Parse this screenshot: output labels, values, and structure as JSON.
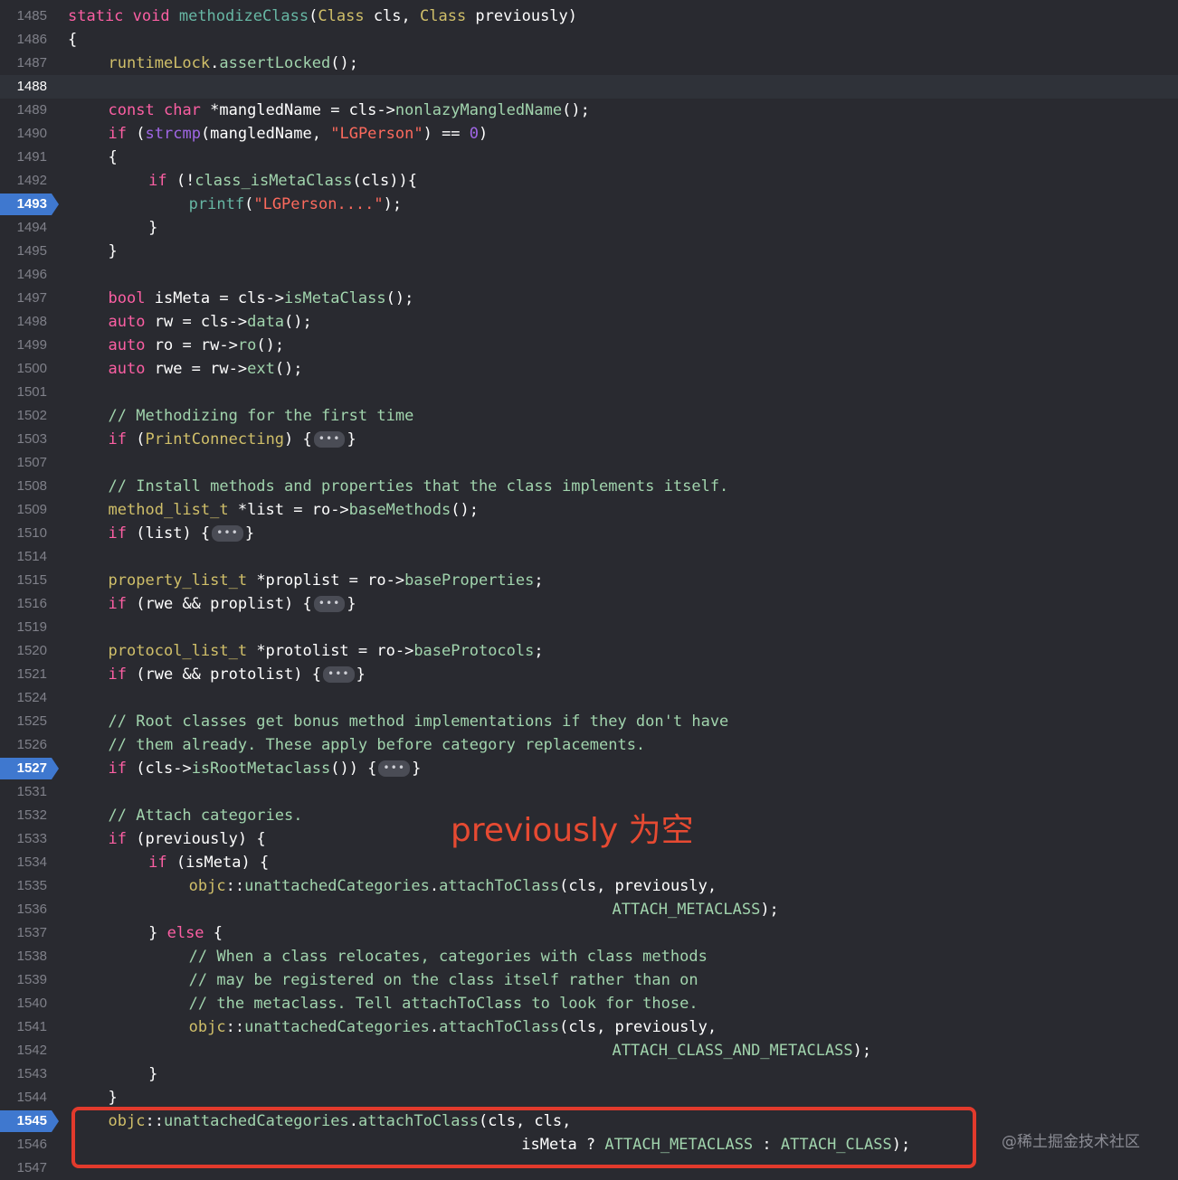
{
  "annotation": "previously 为空",
  "watermark": "@稀土掘金技术社区",
  "lines": [
    {
      "n": "1485",
      "indent": 0,
      "tokens": [
        [
          "static ",
          "k"
        ],
        [
          "void ",
          "k"
        ],
        [
          "methodizeClass",
          "f"
        ],
        [
          "(",
          ""
        ],
        [
          "Class ",
          "t"
        ],
        [
          "cls, ",
          ""
        ],
        [
          "Class ",
          "t"
        ],
        [
          "previously)",
          ""
        ]
      ]
    },
    {
      "n": "1486",
      "indent": 0,
      "tokens": [
        [
          "{",
          ""
        ]
      ]
    },
    {
      "n": "1487",
      "indent": 1,
      "tokens": [
        [
          "runtimeLock",
          "n"
        ],
        [
          ".",
          ""
        ],
        [
          "assertLocked",
          "m"
        ],
        [
          "();",
          ""
        ]
      ]
    },
    {
      "n": "1488",
      "indent": 0,
      "current": true,
      "tokens": []
    },
    {
      "n": "1489",
      "indent": 1,
      "tokens": [
        [
          "const ",
          "k"
        ],
        [
          "char ",
          "k"
        ],
        [
          "*mangledName = cls->",
          ""
        ],
        [
          "nonlazyMangledName",
          "m"
        ],
        [
          "();",
          ""
        ]
      ]
    },
    {
      "n": "1490",
      "indent": 1,
      "tokens": [
        [
          "if ",
          "k"
        ],
        [
          "(",
          ""
        ],
        [
          "strcmp",
          "fn"
        ],
        [
          "(mangledName, ",
          ""
        ],
        [
          "\"LGPerson\"",
          "s"
        ],
        [
          ") == ",
          ""
        ],
        [
          "0",
          "fn"
        ],
        [
          ")",
          ""
        ]
      ]
    },
    {
      "n": "1491",
      "indent": 1,
      "tokens": [
        [
          "{",
          ""
        ]
      ]
    },
    {
      "n": "1492",
      "indent": 2,
      "tokens": [
        [
          "if ",
          "k"
        ],
        [
          "(!",
          ""
        ],
        [
          "class_isMetaClass",
          "m"
        ],
        [
          "(cls)){",
          ""
        ]
      ]
    },
    {
      "n": "1493",
      "indent": 3,
      "bp": true,
      "tokens": [
        [
          "printf",
          "f"
        ],
        [
          "(",
          ""
        ],
        [
          "\"LGPerson....\"",
          "s"
        ],
        [
          ");",
          ""
        ]
      ]
    },
    {
      "n": "1494",
      "indent": 2,
      "tokens": [
        [
          "}",
          ""
        ]
      ]
    },
    {
      "n": "1495",
      "indent": 1,
      "tokens": [
        [
          "}",
          ""
        ]
      ]
    },
    {
      "n": "1496",
      "indent": 0,
      "tokens": []
    },
    {
      "n": "1497",
      "indent": 1,
      "tokens": [
        [
          "bool ",
          "k"
        ],
        [
          "isMeta = cls->",
          ""
        ],
        [
          "isMetaClass",
          "m"
        ],
        [
          "();",
          ""
        ]
      ]
    },
    {
      "n": "1498",
      "indent": 1,
      "tokens": [
        [
          "auto ",
          "k"
        ],
        [
          "rw = cls->",
          ""
        ],
        [
          "data",
          "m"
        ],
        [
          "();",
          ""
        ]
      ]
    },
    {
      "n": "1499",
      "indent": 1,
      "tokens": [
        [
          "auto ",
          "k"
        ],
        [
          "ro = rw->",
          ""
        ],
        [
          "ro",
          "m"
        ],
        [
          "();",
          ""
        ]
      ]
    },
    {
      "n": "1500",
      "indent": 1,
      "tokens": [
        [
          "auto ",
          "k"
        ],
        [
          "rwe = rw->",
          ""
        ],
        [
          "ext",
          "m"
        ],
        [
          "();",
          ""
        ]
      ]
    },
    {
      "n": "1501",
      "indent": 0,
      "tokens": []
    },
    {
      "n": "1502",
      "indent": 1,
      "tokens": [
        [
          "// Methodizing for the first time",
          "m"
        ]
      ]
    },
    {
      "n": "1503",
      "indent": 1,
      "tokens": [
        [
          "if ",
          "k"
        ],
        [
          "(",
          ""
        ],
        [
          "PrintConnecting",
          "n"
        ],
        [
          ") {",
          ""
        ],
        [
          "•••",
          "fold"
        ],
        [
          "}",
          ""
        ]
      ]
    },
    {
      "n": "1507",
      "indent": 0,
      "tokens": []
    },
    {
      "n": "1508",
      "indent": 1,
      "tokens": [
        [
          "// Install methods and properties that the class implements itself.",
          "m"
        ]
      ]
    },
    {
      "n": "1509",
      "indent": 1,
      "tokens": [
        [
          "method_list_t ",
          "n"
        ],
        [
          "*list = ro->",
          ""
        ],
        [
          "baseMethods",
          "m"
        ],
        [
          "();",
          ""
        ]
      ]
    },
    {
      "n": "1510",
      "indent": 1,
      "tokens": [
        [
          "if ",
          "k"
        ],
        [
          "(list) {",
          ""
        ],
        [
          "•••",
          "fold"
        ],
        [
          "}",
          ""
        ]
      ]
    },
    {
      "n": "1514",
      "indent": 0,
      "tokens": []
    },
    {
      "n": "1515",
      "indent": 1,
      "tokens": [
        [
          "property_list_t ",
          "n"
        ],
        [
          "*proplist = ro->",
          ""
        ],
        [
          "baseProperties",
          "m"
        ],
        [
          ";",
          ""
        ]
      ]
    },
    {
      "n": "1516",
      "indent": 1,
      "tokens": [
        [
          "if ",
          "k"
        ],
        [
          "(rwe && proplist) {",
          ""
        ],
        [
          "•••",
          "fold"
        ],
        [
          "}",
          ""
        ]
      ]
    },
    {
      "n": "1519",
      "indent": 0,
      "tokens": []
    },
    {
      "n": "1520",
      "indent": 1,
      "tokens": [
        [
          "protocol_list_t ",
          "n"
        ],
        [
          "*protolist = ro->",
          ""
        ],
        [
          "baseProtocols",
          "m"
        ],
        [
          ";",
          ""
        ]
      ]
    },
    {
      "n": "1521",
      "indent": 1,
      "tokens": [
        [
          "if ",
          "k"
        ],
        [
          "(rwe && protolist) {",
          ""
        ],
        [
          "•••",
          "fold"
        ],
        [
          "}",
          ""
        ]
      ]
    },
    {
      "n": "1524",
      "indent": 0,
      "tokens": []
    },
    {
      "n": "1525",
      "indent": 1,
      "tokens": [
        [
          "// Root classes get bonus method implementations if they don't have",
          "m"
        ]
      ]
    },
    {
      "n": "1526",
      "indent": 1,
      "tokens": [
        [
          "// them already. These apply before category replacements.",
          "m"
        ]
      ]
    },
    {
      "n": "1527",
      "indent": 1,
      "bp": true,
      "tokens": [
        [
          "if ",
          "k"
        ],
        [
          "(cls->",
          ""
        ],
        [
          "isRootMetaclass",
          "m"
        ],
        [
          "()) {",
          ""
        ],
        [
          "•••",
          "fold"
        ],
        [
          "}",
          ""
        ]
      ]
    },
    {
      "n": "1531",
      "indent": 0,
      "tokens": []
    },
    {
      "n": "1532",
      "indent": 1,
      "tokens": [
        [
          "// Attach categories.",
          "m"
        ]
      ]
    },
    {
      "n": "1533",
      "indent": 1,
      "tokens": [
        [
          "if ",
          "k"
        ],
        [
          "(previously) {",
          ""
        ]
      ]
    },
    {
      "n": "1534",
      "indent": 2,
      "tokens": [
        [
          "if ",
          "k"
        ],
        [
          "(isMeta) {",
          ""
        ]
      ]
    },
    {
      "n": "1535",
      "indent": 3,
      "tokens": [
        [
          "objc",
          "n"
        ],
        [
          "::",
          ""
        ],
        [
          "unattachedCategories",
          "m"
        ],
        [
          ".",
          ""
        ],
        [
          "attachToClass",
          "m"
        ],
        [
          "(cls, previously,",
          ""
        ]
      ]
    },
    {
      "n": "1536",
      "indent": 13.5,
      "tokens": [
        [
          "ATTACH_METACLASS",
          "m"
        ],
        [
          ");",
          ""
        ]
      ]
    },
    {
      "n": "1537",
      "indent": 2,
      "tokens": [
        [
          "} ",
          ""
        ],
        [
          "else ",
          "k"
        ],
        [
          "{",
          ""
        ]
      ]
    },
    {
      "n": "1538",
      "indent": 3,
      "tokens": [
        [
          "// When a class relocates, categories with class methods",
          "m"
        ]
      ]
    },
    {
      "n": "1539",
      "indent": 3,
      "tokens": [
        [
          "// may be registered on the class itself rather than on",
          "m"
        ]
      ]
    },
    {
      "n": "1540",
      "indent": 3,
      "tokens": [
        [
          "// the metaclass. Tell attachToClass to look for those.",
          "m"
        ]
      ]
    },
    {
      "n": "1541",
      "indent": 3,
      "tokens": [
        [
          "objc",
          "n"
        ],
        [
          "::",
          ""
        ],
        [
          "unattachedCategories",
          "m"
        ],
        [
          ".",
          ""
        ],
        [
          "attachToClass",
          "m"
        ],
        [
          "(cls, previously,",
          ""
        ]
      ]
    },
    {
      "n": "1542",
      "indent": 13.5,
      "tokens": [
        [
          "ATTACH_CLASS_AND_METACLASS",
          "m"
        ],
        [
          ");",
          ""
        ]
      ]
    },
    {
      "n": "1543",
      "indent": 2,
      "tokens": [
        [
          "}",
          ""
        ]
      ]
    },
    {
      "n": "1544",
      "indent": 1,
      "tokens": [
        [
          "}",
          ""
        ]
      ]
    },
    {
      "n": "1545",
      "indent": 1,
      "bp": true,
      "tokens": [
        [
          "objc",
          "n"
        ],
        [
          "::",
          ""
        ],
        [
          "unattachedCategories",
          "m"
        ],
        [
          ".",
          ""
        ],
        [
          "attachToClass",
          "m"
        ],
        [
          "(cls, cls,",
          ""
        ]
      ]
    },
    {
      "n": "1546",
      "indent": 11.25,
      "tokens": [
        [
          "isMeta ? ",
          ""
        ],
        [
          "ATTACH_METACLASS",
          "m"
        ],
        [
          " : ",
          ""
        ],
        [
          "ATTACH_CLASS",
          "m"
        ],
        [
          ");",
          ""
        ]
      ]
    },
    {
      "n": "1547",
      "indent": 0,
      "tokens": []
    }
  ]
}
